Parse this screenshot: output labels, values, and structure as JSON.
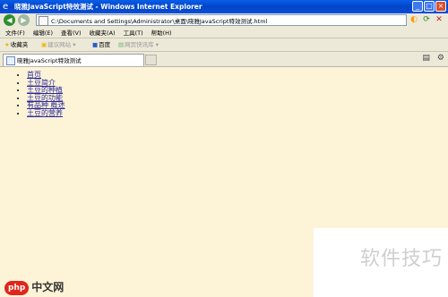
{
  "window": {
    "title": "晓雅JavaScript特效测试 - Windows Internet Explorer"
  },
  "address": {
    "url": "C:\\Documents and Settings\\Administrator\\桌面\\晓雅JavaScript特效测试.html"
  },
  "menu": {
    "items": [
      "文件(F)",
      "编辑(E)",
      "查看(V)",
      "收藏夹(A)",
      "工具(T)",
      "帮助(H)"
    ]
  },
  "favorites": {
    "label": "收藏夹",
    "items": [
      "建议网站 ▾",
      "百度",
      "网页快讯库 ▾"
    ]
  },
  "tab": {
    "title": "晓雅JavaScript特效测试"
  },
  "page": {
    "links": [
      "首页",
      "土豆简介",
      "土豆的种植",
      "土豆的功能",
      "有品种 概述",
      "土豆的营养"
    ]
  },
  "watermark": {
    "text": "软件技巧",
    "logo": "php",
    "logo_suffix": "中文网"
  }
}
